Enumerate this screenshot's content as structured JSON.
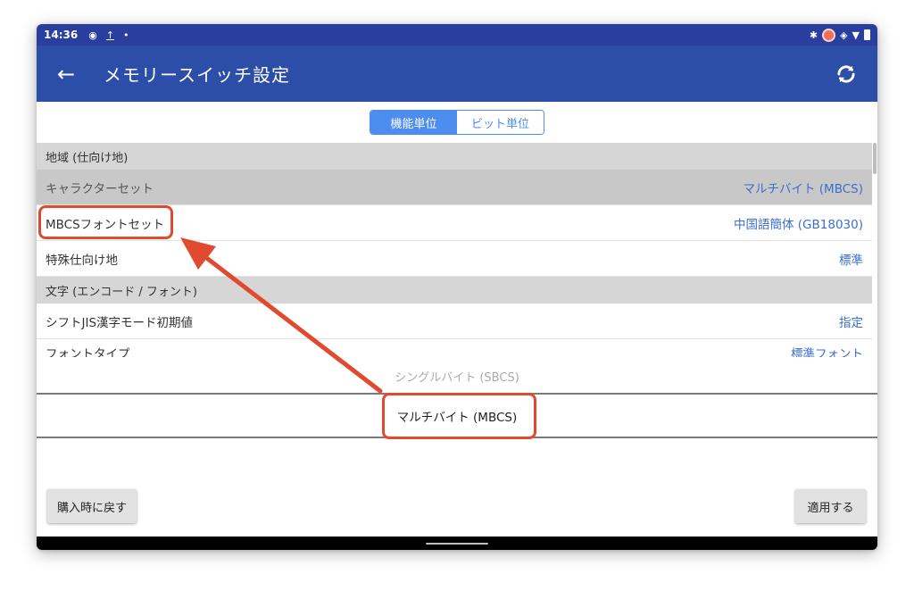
{
  "status_bar": {
    "time": "14:36",
    "left_icons": [
      "target-icon",
      "upload-icon",
      "dot-icon"
    ],
    "right_icons": [
      "bluetooth-icon",
      "record-icon",
      "vibrate-icon",
      "wifi-icon",
      "battery-icon"
    ]
  },
  "app_bar": {
    "title": "メモリースイッチ設定",
    "back_icon": "arrow-left-icon",
    "refresh_icon": "refresh-icon",
    "color": "#2c4ea8"
  },
  "segment": {
    "options": [
      "機能単位",
      "ビット単位"
    ],
    "selected": "機能単位",
    "accent": "#4d8df0"
  },
  "list": {
    "section1_title": "地域 (仕向け地)",
    "rows": [
      {
        "label": "キャラクターセット",
        "value": "マルチバイト (MBCS)"
      },
      {
        "label": "MBCSフォントセット",
        "value": "中国語簡体 (GB18030)"
      },
      {
        "label": "特殊仕向け地",
        "value": "標準"
      }
    ],
    "section2_title": "文字 (エンコード / フォント)",
    "rows2": [
      {
        "label": "シフトJIS漢字モード初期値",
        "value": "指定"
      },
      {
        "label": "フォントタイプ",
        "value": "標準フォント"
      }
    ]
  },
  "picker": {
    "options": [
      "シングルバイト (SBCS)",
      "マルチバイト (MBCS)"
    ],
    "selected": "マルチバイト (MBCS)"
  },
  "buttons": {
    "reset": "購入時に戻す",
    "apply": "適用する"
  },
  "annotation": {
    "color": "#e04a2f"
  }
}
